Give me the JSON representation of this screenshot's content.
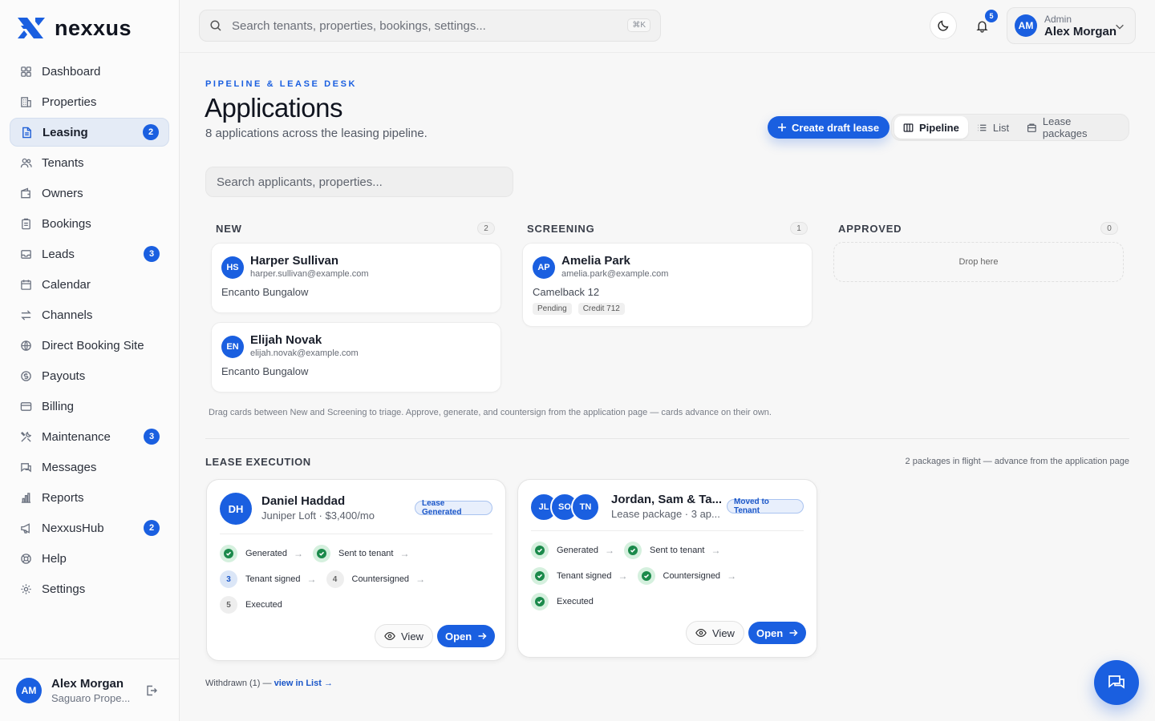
{
  "brand": {
    "name": "nexxus",
    "accent": "#1a5fe0"
  },
  "sidebar": {
    "items": [
      {
        "label": "Dashboard",
        "icon": "grid-icon",
        "badge": ""
      },
      {
        "label": "Properties",
        "icon": "building-icon",
        "badge": ""
      },
      {
        "label": "Leasing",
        "icon": "document-icon",
        "badge": "2",
        "active": true
      },
      {
        "label": "Tenants",
        "icon": "users-icon",
        "badge": ""
      },
      {
        "label": "Owners",
        "icon": "wallet-icon",
        "badge": ""
      },
      {
        "label": "Bookings",
        "icon": "clipboard-icon",
        "badge": ""
      },
      {
        "label": "Leads",
        "icon": "inbox-icon",
        "badge": "3"
      },
      {
        "label": "Calendar",
        "icon": "calendar-icon",
        "badge": ""
      },
      {
        "label": "Channels",
        "icon": "arrows-icon",
        "badge": ""
      },
      {
        "label": "Direct Booking Site",
        "icon": "globe-icon",
        "badge": ""
      },
      {
        "label": "Payouts",
        "icon": "dollar-icon",
        "badge": ""
      },
      {
        "label": "Billing",
        "icon": "card-icon",
        "badge": ""
      },
      {
        "label": "Maintenance",
        "icon": "tools-icon",
        "badge": "3"
      },
      {
        "label": "Messages",
        "icon": "chat-icon",
        "badge": ""
      },
      {
        "label": "Reports",
        "icon": "bar-chart-icon",
        "badge": ""
      },
      {
        "label": "NexxusHub",
        "icon": "megaphone-icon",
        "badge": "2"
      },
      {
        "label": "Help",
        "icon": "lifebuoy-icon",
        "badge": ""
      },
      {
        "label": "Settings",
        "icon": "gear-icon",
        "badge": ""
      }
    ],
    "user": {
      "initials": "AM",
      "name": "Alex Morgan",
      "org": "Saguaro Prope..."
    }
  },
  "topbar": {
    "search_placeholder": "Search tenants, properties, bookings, settings...",
    "shortcut": "⌘K",
    "notification_count": "5",
    "user": {
      "initials": "AM",
      "role": "Admin",
      "name": "Alex Morgan"
    }
  },
  "page": {
    "eyebrow": "PIPELINE & LEASE DESK",
    "title": "Applications",
    "subtitle": "8 applications across the leasing pipeline.",
    "create_button": "Create draft lease",
    "views": [
      "Pipeline",
      "List",
      "Lease packages"
    ],
    "search_placeholder": "Search applicants, properties..."
  },
  "pipeline": {
    "columns": [
      {
        "title": "NEW",
        "count": "2",
        "cards": [
          {
            "initials": "HS",
            "name": "Harper Sullivan",
            "email": "harper.sullivan@example.com",
            "property": "Encanto Bungalow",
            "chips": []
          },
          {
            "initials": "EN",
            "name": "Elijah Novak",
            "email": "elijah.novak@example.com",
            "property": "Encanto Bungalow",
            "chips": []
          }
        ]
      },
      {
        "title": "SCREENING",
        "count": "1",
        "cards": [
          {
            "initials": "AP",
            "name": "Amelia Park",
            "email": "amelia.park@example.com",
            "property": "Camelback 12",
            "chips": [
              "Pending",
              "Credit 712"
            ]
          }
        ]
      },
      {
        "title": "APPROVED",
        "count": "0",
        "cards": [],
        "drop_text": "Drop here"
      }
    ],
    "hint": "Drag cards between New and Screening to triage. Approve, generate, and countersign from the application page — cards advance on their own."
  },
  "lease_execution": {
    "title": "LEASE EXECUTION",
    "note": "2 packages in flight — advance from the application page",
    "packages": [
      {
        "initials": [
          "DH"
        ],
        "name": "Daniel Haddad",
        "subtitle": "Juniper Loft · $3,400/mo",
        "status": "Lease Generated",
        "steps": [
          {
            "label": "Generated",
            "state": "done",
            "num": "1"
          },
          {
            "label": "Sent to tenant",
            "state": "done",
            "num": "2"
          },
          {
            "label": "Tenant signed",
            "state": "current",
            "num": "3"
          },
          {
            "label": "Countersigned",
            "state": "todo",
            "num": "4"
          },
          {
            "label": "Executed",
            "state": "todo",
            "num": "5"
          }
        ],
        "view_label": "View",
        "open_label": "Open"
      },
      {
        "initials": [
          "JL",
          "SO",
          "TN"
        ],
        "name": "Jordan, Sam & Ta...",
        "subtitle": "Lease package · 3 ap...",
        "status": "Moved to Tenant",
        "steps": [
          {
            "label": "Generated",
            "state": "done",
            "num": "1"
          },
          {
            "label": "Sent to tenant",
            "state": "done",
            "num": "2"
          },
          {
            "label": "Tenant signed",
            "state": "done",
            "num": "3"
          },
          {
            "label": "Countersigned",
            "state": "done",
            "num": "4"
          },
          {
            "label": "Executed",
            "state": "done",
            "num": "5"
          }
        ],
        "view_label": "View",
        "open_label": "Open"
      }
    ],
    "withdrawn_text": "Withdrawn (1) —",
    "withdrawn_link": "view in List →"
  }
}
